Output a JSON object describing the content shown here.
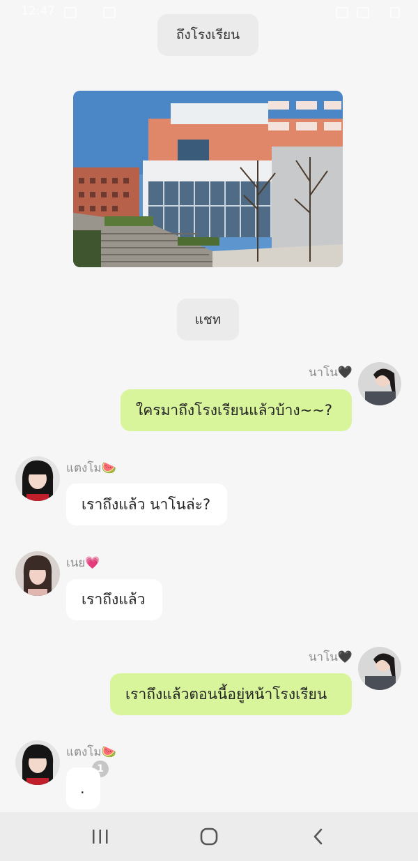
{
  "status_bar": {
    "time": "12:47"
  },
  "chat": {
    "system_messages": {
      "arrived_at_school": "ถึงโรงเรียน",
      "chat": "แชท"
    },
    "photo": {
      "description_icon": "school-building-photo"
    },
    "messages": [
      {
        "sender": "นาโน🖤",
        "text": "ใครมาถึงโรงเรียนแล้วบ้าง~~?",
        "outgoing": true
      },
      {
        "sender": "แตงโม🍉",
        "text": "เราถึงแล้ว นาโนล่ะ?",
        "outgoing": false
      },
      {
        "sender": "เนย💗",
        "text": "เราถึงแล้ว",
        "outgoing": false
      },
      {
        "sender": "นาโน🖤",
        "text": "เราถึงแล้วตอนนี้อยู่หน้าโรงเรียน",
        "outgoing": true
      },
      {
        "sender": "แตงโม🍉",
        "text": ".",
        "outgoing": false,
        "unread_count": "1"
      }
    ]
  },
  "colors": {
    "outgoing_bubble": "#d9f59c",
    "incoming_bubble": "#ffffff",
    "background": "#f6f6f6",
    "system_pill": "#ebebeb"
  },
  "nav_bar": {
    "recents_icon": "recents-icon",
    "home_icon": "home-icon",
    "back_icon": "back-icon"
  }
}
